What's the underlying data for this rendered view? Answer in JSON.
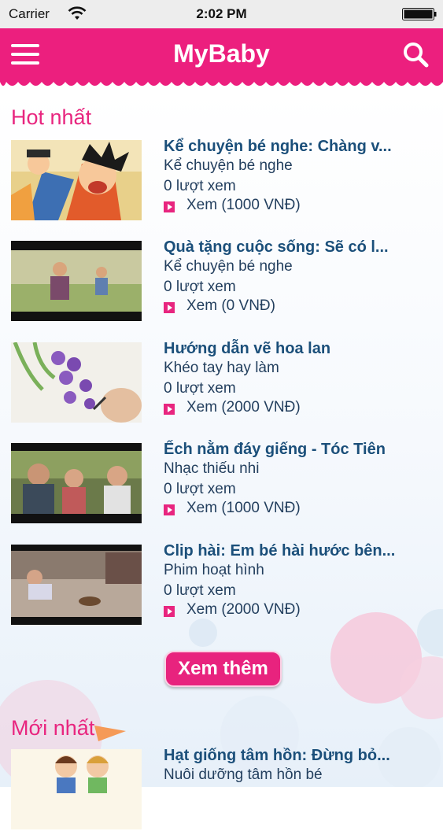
{
  "status_bar": {
    "carrier": "Carrier",
    "time": "2:02 PM"
  },
  "header": {
    "title": "MyBaby",
    "menu_icon": "hamburger-menu-icon",
    "search_icon": "search-icon"
  },
  "colors": {
    "accent": "#ec1f7e",
    "title_text": "#1b4f7a",
    "body_text": "#233f5e"
  },
  "hot": {
    "heading": "Hot nhất",
    "items": [
      {
        "title": "Kể chuyện bé nghe: Chàng v...",
        "category": "Kể chuyện bé nghe",
        "views": "0 lượt xem",
        "watch": "Xem (1000 VNĐ)"
      },
      {
        "title": "Quà tặng cuộc sống: Sẽ có l...",
        "category": "Kể chuyện bé nghe",
        "views": "0 lượt xem",
        "watch": "Xem (0 VNĐ)"
      },
      {
        "title": "Hướng dẫn vẽ hoa lan",
        "category": "Khéo tay hay làm",
        "views": "0 lượt xem",
        "watch": "Xem (2000 VNĐ)"
      },
      {
        "title": "Ếch nằm đáy giếng - Tóc Tiên",
        "category": "Nhạc thiếu nhi",
        "views": "0 lượt xem",
        "watch": "Xem (1000 VNĐ)"
      },
      {
        "title": "Clip hài: Em bé hài hước bên...",
        "category": "Phim hoạt hình",
        "views": "0 lượt xem",
        "watch": "Xem (2000 VNĐ)"
      }
    ],
    "more_label": "Xem thêm"
  },
  "new": {
    "heading": "Mới nhất",
    "items": [
      {
        "title": "Hạt giống tâm hồn: Đừng bỏ...",
        "category": "Nuôi dưỡng tâm hồn bé"
      }
    ]
  }
}
